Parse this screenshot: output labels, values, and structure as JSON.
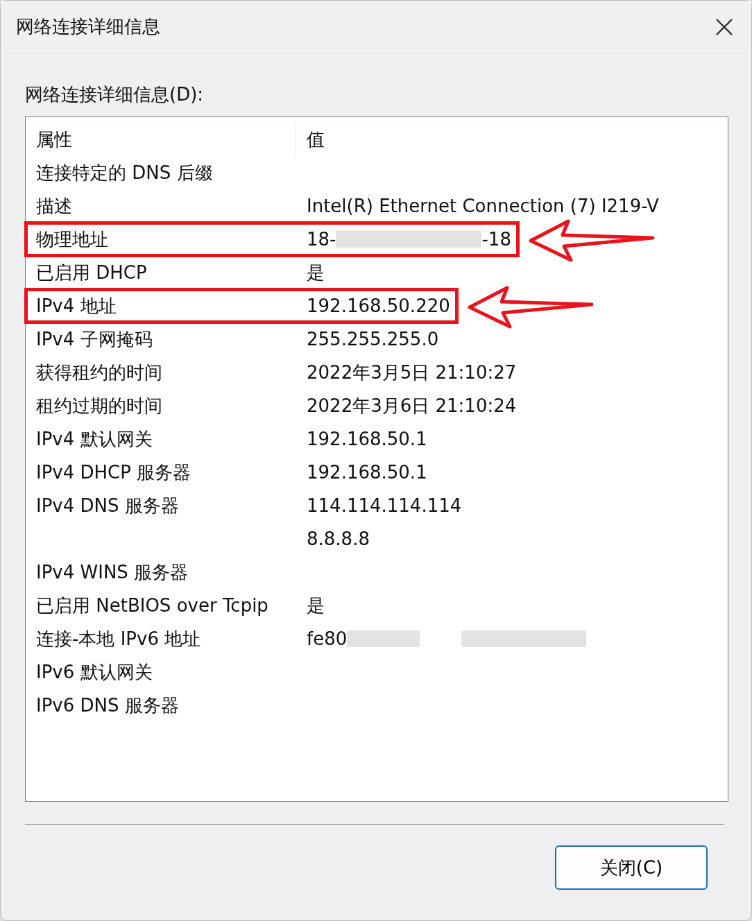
{
  "window": {
    "title": "网络连接详细信息"
  },
  "details": {
    "label": "网络连接详细信息(D):",
    "columns": [
      "属性",
      "值"
    ],
    "rows": [
      {
        "property": "连接特定的 DNS 后缀",
        "value": "",
        "highlighted": false,
        "redacted": false
      },
      {
        "property": "描述",
        "value": "Intel(R) Ethernet Connection (7) I219-V",
        "highlighted": false,
        "redacted": false
      },
      {
        "property": "物理地址",
        "value": "18-",
        "value_end": "-18",
        "highlighted": true,
        "redacted": true
      },
      {
        "property": "已启用 DHCP",
        "value": "是",
        "highlighted": false,
        "redacted": false
      },
      {
        "property": "IPv4 地址",
        "value": "192.168.50.220",
        "highlighted": true,
        "redacted": false
      },
      {
        "property": "IPv4 子网掩码",
        "value": "255.255.255.0",
        "highlighted": false,
        "redacted": false
      },
      {
        "property": "获得租约的时间",
        "value": "2022年3月5日 21:10:27",
        "highlighted": false,
        "redacted": false
      },
      {
        "property": "租约过期的时间",
        "value": "2022年3月6日 21:10:24",
        "highlighted": false,
        "redacted": false
      },
      {
        "property": "IPv4 默认网关",
        "value": "192.168.50.1",
        "highlighted": false,
        "redacted": false
      },
      {
        "property": "IPv4 DHCP 服务器",
        "value": "192.168.50.1",
        "highlighted": false,
        "redacted": false
      },
      {
        "property": "IPv4 DNS 服务器",
        "value": "114.114.114.114",
        "highlighted": false,
        "redacted": false
      },
      {
        "property": "",
        "value": "8.8.8.8",
        "highlighted": false,
        "redacted": false
      },
      {
        "property": "IPv4 WINS 服务器",
        "value": "",
        "highlighted": false,
        "redacted": false
      },
      {
        "property": "已启用 NetBIOS over Tcpip",
        "value": "是",
        "highlighted": false,
        "redacted": false
      },
      {
        "property": "连接-本地 IPv6 地址",
        "value": "fe80",
        "highlighted": false,
        "redacted": true
      },
      {
        "property": "IPv6 默认网关",
        "value": "",
        "highlighted": false,
        "redacted": false
      },
      {
        "property": "IPv6 DNS 服务器",
        "value": "",
        "highlighted": false,
        "redacted": false
      }
    ]
  },
  "buttons": [
    "关闭(C)"
  ]
}
